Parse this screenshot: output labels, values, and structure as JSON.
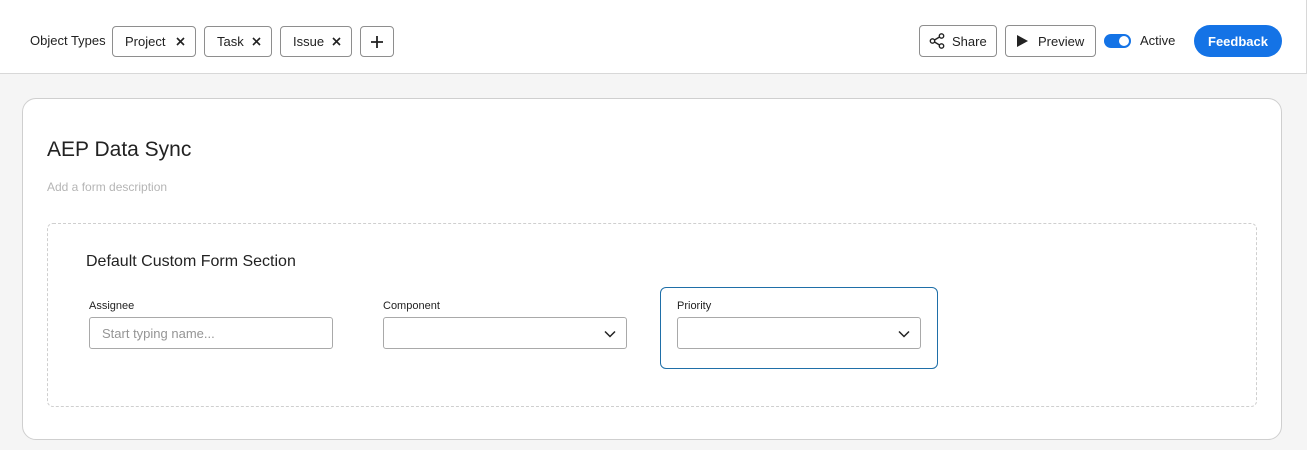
{
  "toolbar": {
    "object_types_label": "Object Types",
    "chips": [
      {
        "label": "Project"
      },
      {
        "label": "Task"
      },
      {
        "label": "Issue"
      }
    ],
    "share_label": "Share",
    "preview_label": "Preview",
    "active_label": "Active",
    "active_on": true,
    "feedback_label": "Feedback",
    "accent_color": "#1473e6"
  },
  "form": {
    "title": "AEP Data Sync",
    "description_placeholder": "Add a form description",
    "section": {
      "title": "Default Custom Form Section",
      "fields": {
        "assignee": {
          "label": "Assignee",
          "placeholder": "Start typing name...",
          "value": ""
        },
        "component": {
          "label": "Component",
          "value": ""
        },
        "priority": {
          "label": "Priority",
          "value": ""
        }
      }
    }
  }
}
